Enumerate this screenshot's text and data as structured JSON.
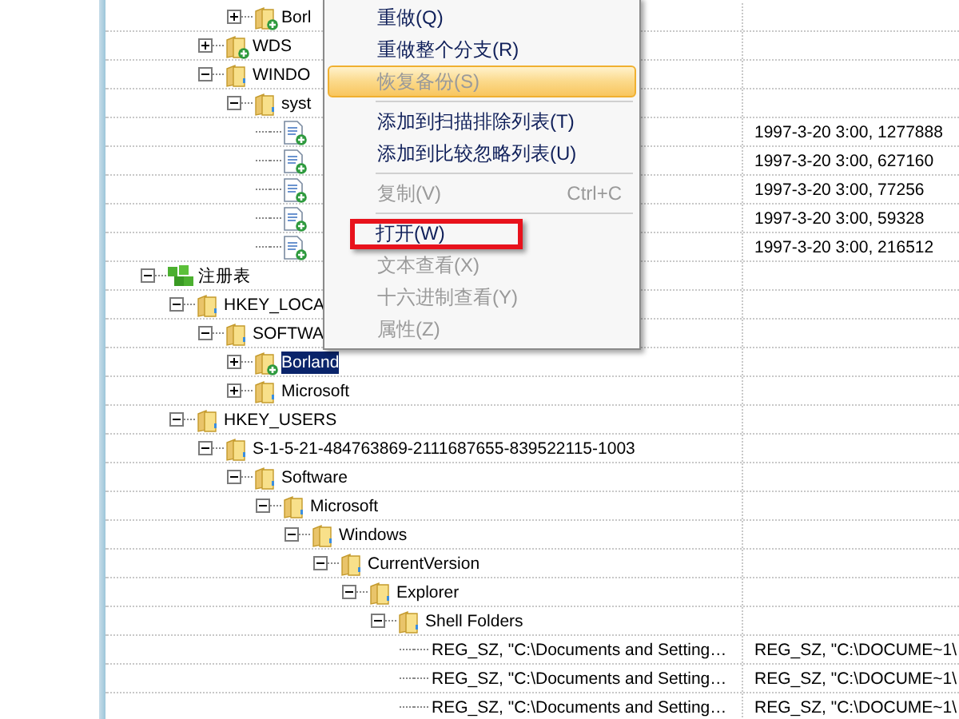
{
  "file_tree": [
    {
      "kind": "folder",
      "expanded": true,
      "children": [
        {
          "label": "Borl",
          "kind": "folder-add",
          "expanded": false,
          "selected": false
        }
      ]
    },
    {
      "label": "WDS",
      "kind": "folder-add",
      "expanded": false,
      "selected": false
    },
    {
      "label": "WINDO",
      "kind": "folder",
      "expanded": true,
      "selected": false,
      "children": [
        {
          "label": "syst",
          "kind": "folder",
          "expanded": true,
          "selected": false,
          "children": [
            {
              "kind": "file-add",
              "column_2": "1997-3-20 3:00, 1277888"
            },
            {
              "kind": "file-add",
              "column_2": "1997-3-20 3:00, 627160"
            },
            {
              "kind": "file-add",
              "column_2": "1997-3-20 3:00, 77256"
            },
            {
              "kind": "file-add",
              "column_2": "1997-3-20 3:00, 59328"
            },
            {
              "kind": "file-add",
              "column_2": "1997-3-20 3:00, 216512"
            }
          ]
        }
      ]
    }
  ],
  "registry_tree": [
    {
      "label": "注册表",
      "kind": "registry",
      "expanded": true,
      "selected": false,
      "children": [
        {
          "label": "HKEY_LOCA",
          "kind": "folder",
          "expanded": true,
          "selected": false,
          "children": [
            {
              "label": "SOFTWA",
              "kind": "folder",
              "expanded": true,
              "selected": false,
              "children": [
                {
                  "label": "Borland",
                  "kind": "folder-add",
                  "expanded": false,
                  "selected": true
                },
                {
                  "label": "Microsoft",
                  "kind": "folder",
                  "expanded": false,
                  "selected": false
                }
              ]
            }
          ]
        },
        {
          "label": "HKEY_USERS",
          "kind": "folder",
          "expanded": true,
          "selected": false,
          "children": [
            {
              "label": "S-1-5-21-484763869-2111687655-839522115-1003",
              "kind": "folder",
              "expanded": true,
              "selected": false,
              "children": [
                {
                  "label": "Software",
                  "kind": "folder",
                  "expanded": true,
                  "selected": false,
                  "children": [
                    {
                      "label": "Microsoft",
                      "kind": "folder",
                      "expanded": true,
                      "selected": false,
                      "children": [
                        {
                          "label": "Windows",
                          "kind": "folder",
                          "expanded": true,
                          "selected": false,
                          "children": [
                            {
                              "label": "CurrentVersion",
                              "kind": "folder",
                              "expanded": true,
                              "selected": false,
                              "children": [
                                {
                                  "label": "Explorer",
                                  "kind": "folder",
                                  "expanded": true,
                                  "selected": false,
                                  "children": [
                                    {
                                      "label": "Shell Folders",
                                      "kind": "folder",
                                      "expanded": true,
                                      "selected": false,
                                      "children": [
                                        {
                                          "label": "REG_SZ, \"C:\\Documents and Setting…",
                                          "kind": "value",
                                          "selected": false,
                                          "column_2": "REG_SZ, \"C:\\DOCUME~1\\"
                                        },
                                        {
                                          "label": "REG_SZ, \"C:\\Documents and Setting…",
                                          "kind": "value",
                                          "selected": false,
                                          "column_2": "REG_SZ, \"C:\\DOCUME~1\\"
                                        },
                                        {
                                          "label": "REG_SZ, \"C:\\Documents and Setting…",
                                          "kind": "value",
                                          "selected": false,
                                          "column_2": "REG_SZ, \"C:\\DOCUME~1\\"
                                        }
                                      ]
                                    }
                                  ]
                                }
                              ]
                            }
                          ]
                        }
                      ]
                    }
                  ]
                }
              ]
            }
          ]
        }
      ]
    }
  ],
  "context_menu": {
    "items": [
      {
        "kind": "item",
        "label": "重做(Q)",
        "disabled": false,
        "selected": false,
        "boxed": false
      },
      {
        "kind": "item",
        "label": "重做整个分支(R)",
        "disabled": false,
        "selected": false,
        "boxed": false
      },
      {
        "kind": "item",
        "label": "恢复备份(S)",
        "disabled": true,
        "selected": true,
        "boxed": false
      },
      {
        "kind": "separator"
      },
      {
        "kind": "item",
        "label": "添加到扫描排除列表(T)",
        "disabled": false,
        "selected": false,
        "boxed": false
      },
      {
        "kind": "item",
        "label": "添加到比较忽略列表(U)",
        "disabled": false,
        "selected": false,
        "boxed": false
      },
      {
        "kind": "separator"
      },
      {
        "kind": "item",
        "label": "复制(V)",
        "shortcut": "Ctrl+C",
        "disabled": true,
        "selected": false,
        "boxed": false
      },
      {
        "kind": "separator"
      },
      {
        "kind": "item",
        "label": "打开(W)",
        "disabled": false,
        "selected": false,
        "boxed": true
      },
      {
        "kind": "item",
        "label": "文本查看(X)",
        "disabled": true,
        "selected": false,
        "boxed": false
      },
      {
        "kind": "item",
        "label": "十六进制查看(Y)",
        "disabled": true,
        "selected": false,
        "boxed": false
      },
      {
        "kind": "item",
        "label": "属性(Z)",
        "disabled": true,
        "selected": false,
        "boxed": false
      }
    ]
  }
}
